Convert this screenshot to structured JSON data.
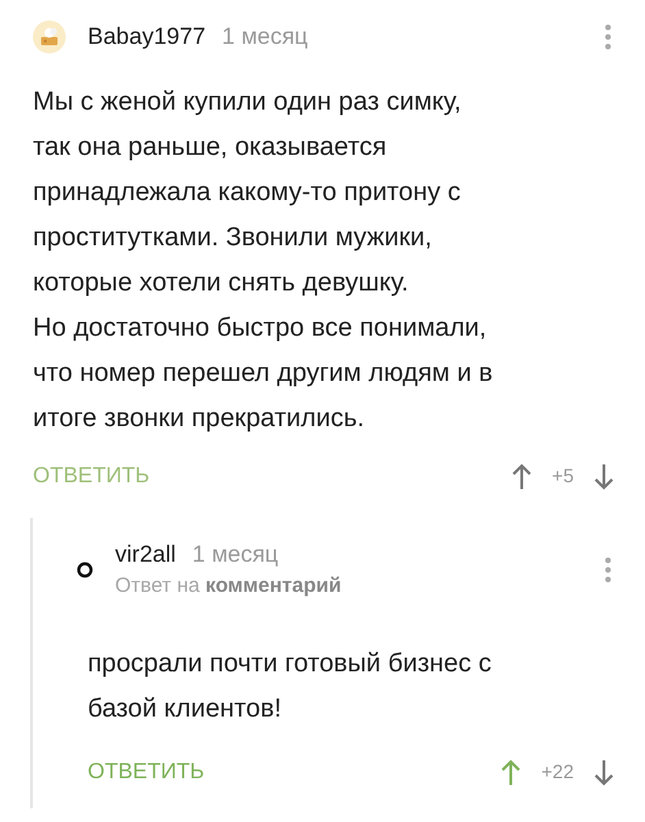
{
  "comments": [
    {
      "author": "Babay1977",
      "time": "1 месяц",
      "kind": "picture",
      "paragraphs": [
        "Мы с женой купили один раз симку,\nтак она раньше,  оказывается\nпринадлежала какому-то притону с\nпроститутками. Звонили мужики,\nкоторые хотели снять девушку.\nНо достаточно быстро все понимали,\nчто номер перешел другим людям и в\nитоге звонки прекратились."
      ],
      "reply_label": "ОТВЕТИТЬ",
      "score": "+5",
      "voted_up": false,
      "children": [
        {
          "author": "vir2all",
          "time": "1 месяц",
          "reply_to": "Ответ на **комментарий**",
          "paragraphs": [
            "просрали почти готовый бизнес с\nбазой клиентов!"
          ],
          "reply_label": "ОТВЕТИТЬ",
          "score": "+22",
          "voted_up": true
        }
      ]
    }
  ]
}
